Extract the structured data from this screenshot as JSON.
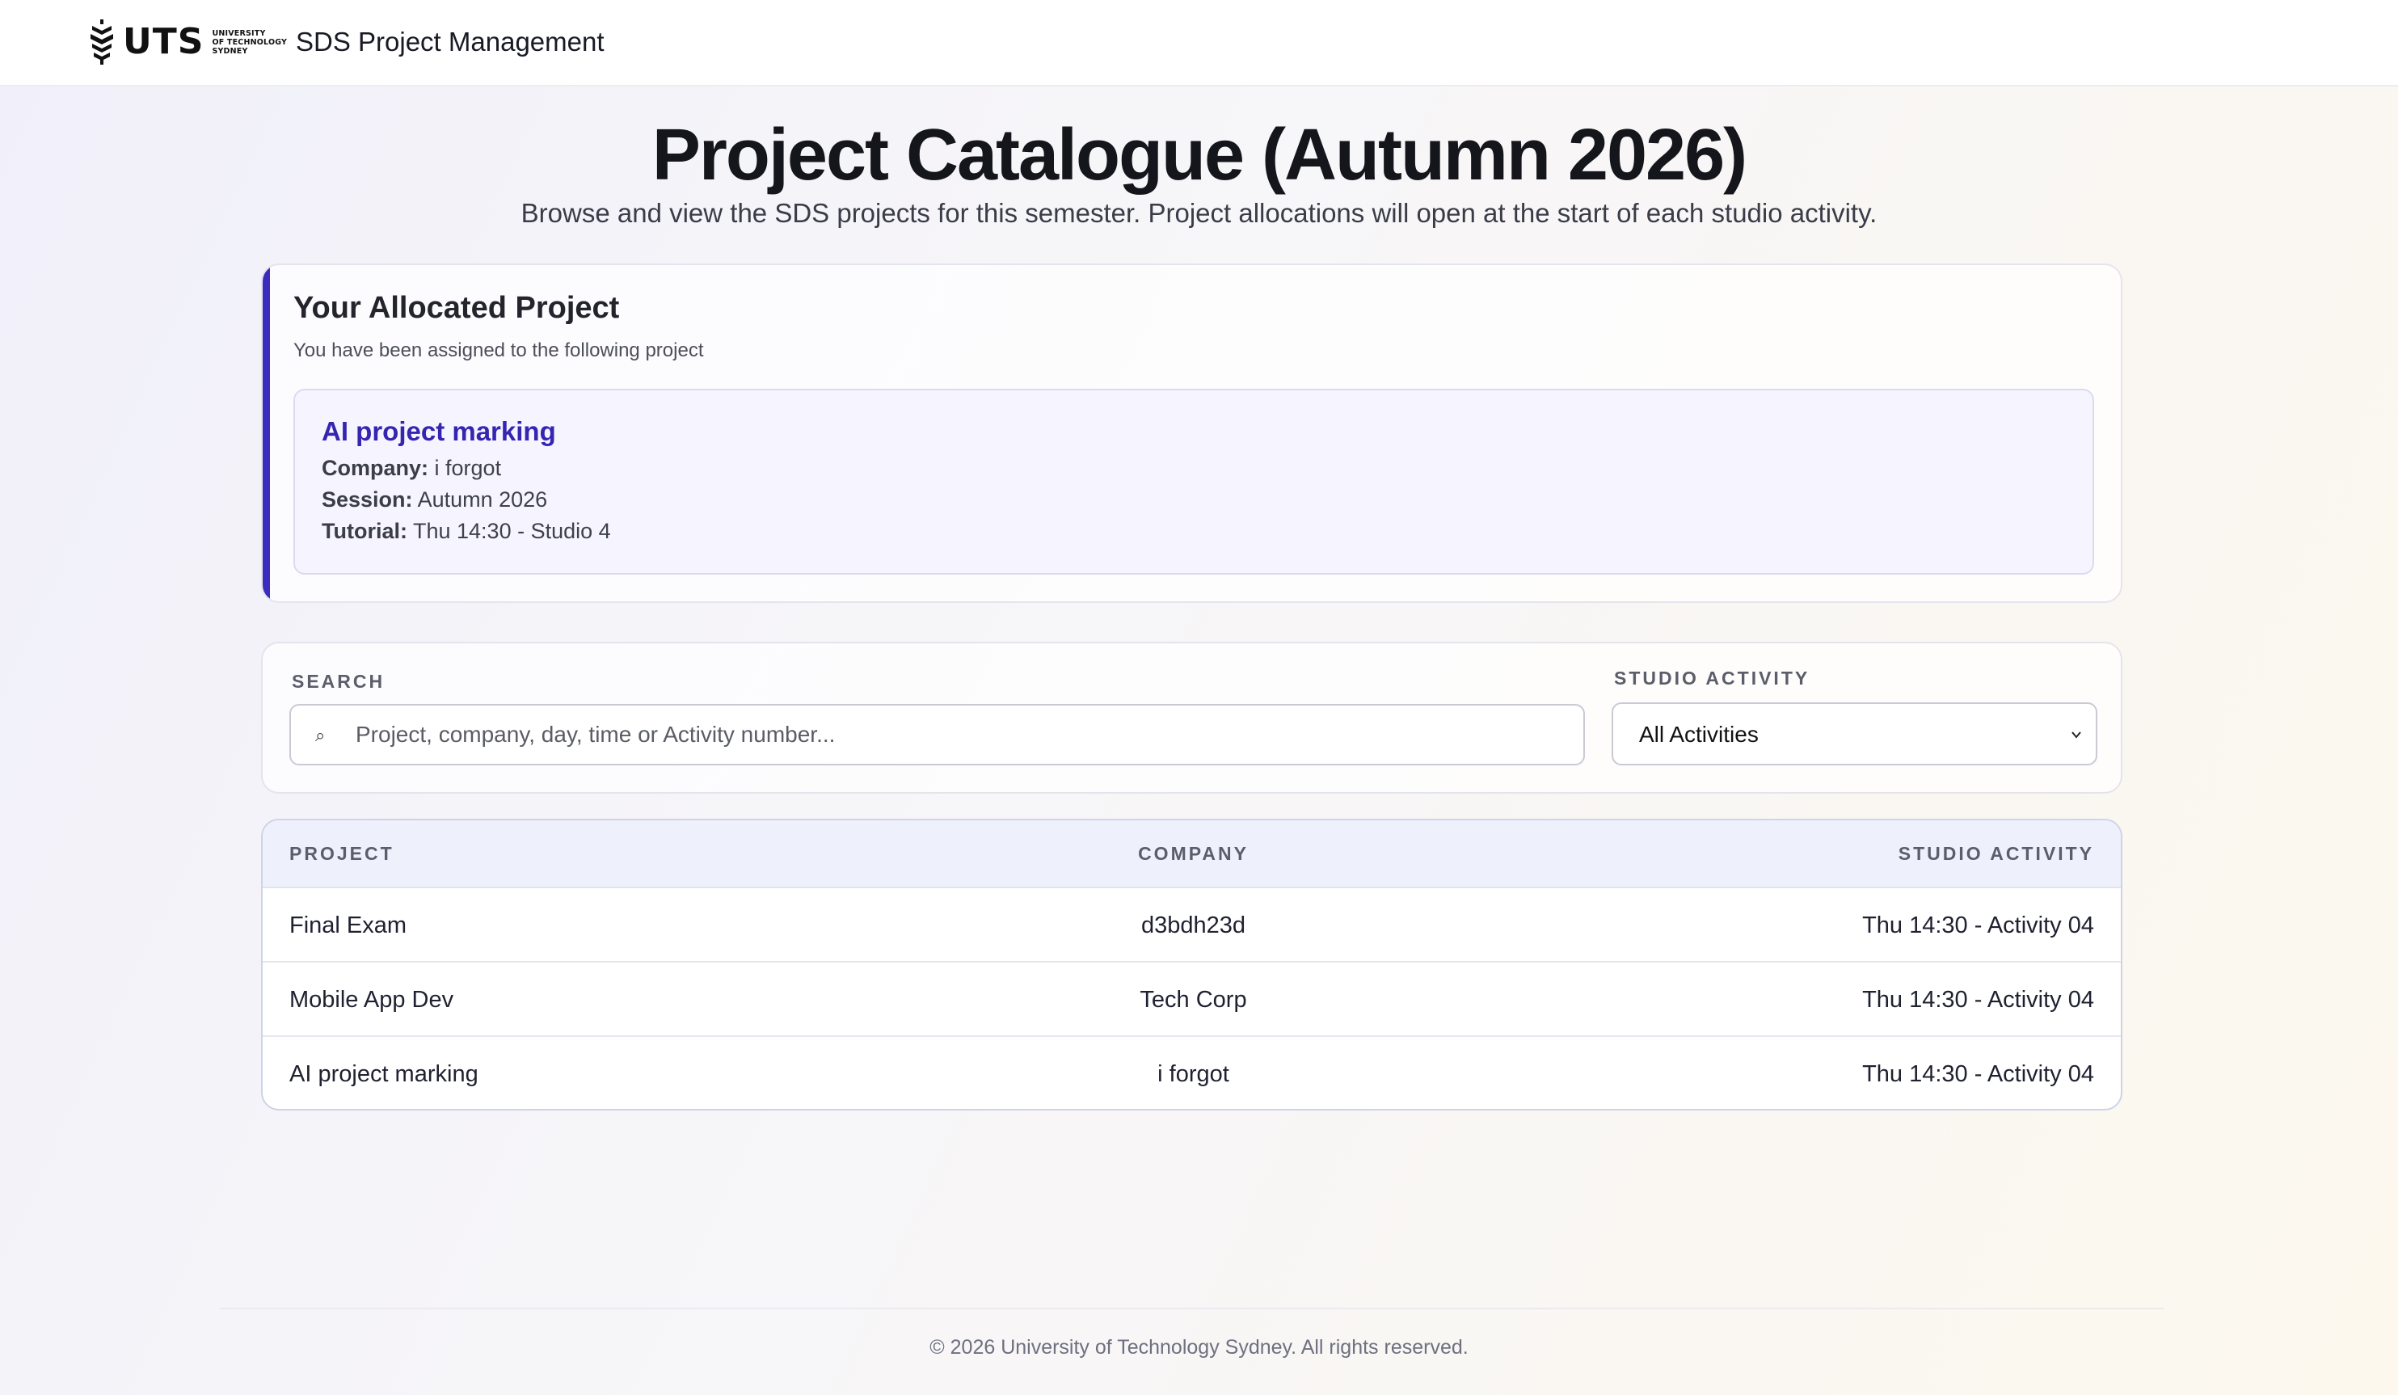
{
  "header": {
    "logo_text": "UTS",
    "logo_lines": [
      "UNIVERSITY",
      "OF TECHNOLOGY",
      "SYDNEY"
    ],
    "app_title": "SDS Project Management"
  },
  "page": {
    "title": "Project Catalogue (Autumn 2026)",
    "subtitle": "Browse and view the SDS projects for this semester. Project allocations will open at the start of each studio activity."
  },
  "allocated": {
    "heading": "Your Allocated Project",
    "subheading": "You have been assigned to the following project",
    "project_name": "AI project marking",
    "company_label": "Company:",
    "company": "i forgot",
    "session_label": "Session:",
    "session": "Autumn 2026",
    "tutorial_label": "Tutorial:",
    "tutorial": "Thu 14:30 - Studio 4"
  },
  "filters": {
    "search_label": "SEARCH",
    "search_icon": "search-icon",
    "search_glyph": "⌕",
    "search_value": "",
    "search_placeholder": "Project, company, day, time or Activity number...",
    "activity_label": "STUDIO ACTIVITY",
    "activity_selected": "All Activities"
  },
  "table": {
    "columns": [
      "PROJECT",
      "COMPANY",
      "STUDIO ACTIVITY"
    ],
    "rows": [
      {
        "project": "Final Exam",
        "company": "d3bdh23d",
        "activity": "Thu 14:30 - Activity 04"
      },
      {
        "project": "Mobile App Dev",
        "company": "Tech Corp",
        "activity": "Thu 14:30 - Activity 04"
      },
      {
        "project": "AI project marking",
        "company": "i forgot",
        "activity": "Thu 14:30 - Activity 04"
      }
    ]
  },
  "footer": {
    "text": "© 2026 University of Technology Sydney. All rights reserved."
  },
  "colors": {
    "accent": "#3b2bbf",
    "project_link": "#3525b0",
    "table_header_bg": "#eef0fc"
  }
}
